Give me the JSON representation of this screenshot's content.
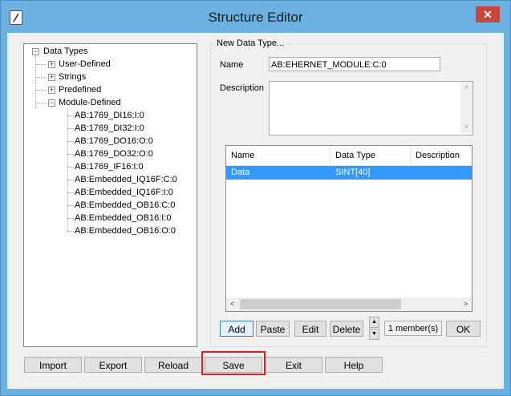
{
  "window": {
    "title": "Structure Editor",
    "close_glyph": "✕"
  },
  "tree": {
    "root": "Data Types",
    "expanders": {
      "collapsed": "+",
      "expanded": "−"
    },
    "children": [
      {
        "label": "User-Defined"
      },
      {
        "label": "Strings"
      },
      {
        "label": "Predefined"
      },
      {
        "label": "Module-Defined"
      }
    ],
    "module_items": [
      "AB:1769_DI16:I:0",
      "AB:1769_DI32:I:0",
      "AB:1769_DO16:O:0",
      "AB:1769_DO32:O:0",
      "AB:1769_IF16:I:0",
      "AB:Embedded_IQ16F:C:0",
      "AB:Embedded_IQ16F:I:0",
      "AB:Embedded_OB16:C:0",
      "AB:Embedded_OB16:I:0",
      "AB:Embedded_OB16:O:0"
    ]
  },
  "group": {
    "label": "New Data Type...",
    "name_label": "Name",
    "name_value": "AB:EHERNET_MODULE:C:0",
    "description_label": "Description",
    "description_value": ""
  },
  "grid": {
    "columns": [
      "Name",
      "Data Type",
      "Description"
    ],
    "rows": [
      {
        "name": "Data",
        "data_type": "SINT[40]",
        "description": ""
      }
    ]
  },
  "scroll": {
    "up": "˄",
    "down": "˅",
    "left": "<",
    "right": ">"
  },
  "member_buttons": {
    "add": "Add",
    "paste": "Paste",
    "edit": "Edit",
    "delete": "Delete",
    "move_up": "▲",
    "move_down": "▼",
    "member_count": "1 member(s)",
    "ok": "OK"
  },
  "bottom_buttons": {
    "import": "Import",
    "export": "Export",
    "reload": "Reload",
    "save": "Save",
    "exit": "Exit",
    "help": "Help"
  },
  "colors": {
    "selection": "#3399ff",
    "highlight_border": "#e02020",
    "titlebar": "#6cb2e0",
    "close_button": "#c9463d"
  }
}
